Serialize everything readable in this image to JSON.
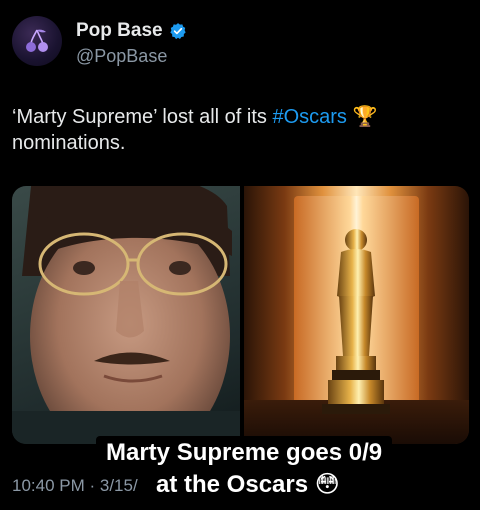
{
  "author": {
    "display_name": "Pop Base",
    "handle": "@PopBase",
    "avatar_icon": "cherries-logo-icon",
    "verified_icon": "verified-badge-icon",
    "verified_color": "#1d9bf0"
  },
  "tweet": {
    "text_before": "‘Marty Supreme’ lost all of its ",
    "hashtag": "#Oscars",
    "emoji": "🏆",
    "text_after": " nominations."
  },
  "media": {
    "left_image": "portrait-photo",
    "right_image": "oscar-statuette-photo"
  },
  "caption": {
    "line1": "Marty Supreme goes 0/9",
    "line2": "at the Oscars 😳"
  },
  "timestamp": "10:40 PM · 3/15/"
}
